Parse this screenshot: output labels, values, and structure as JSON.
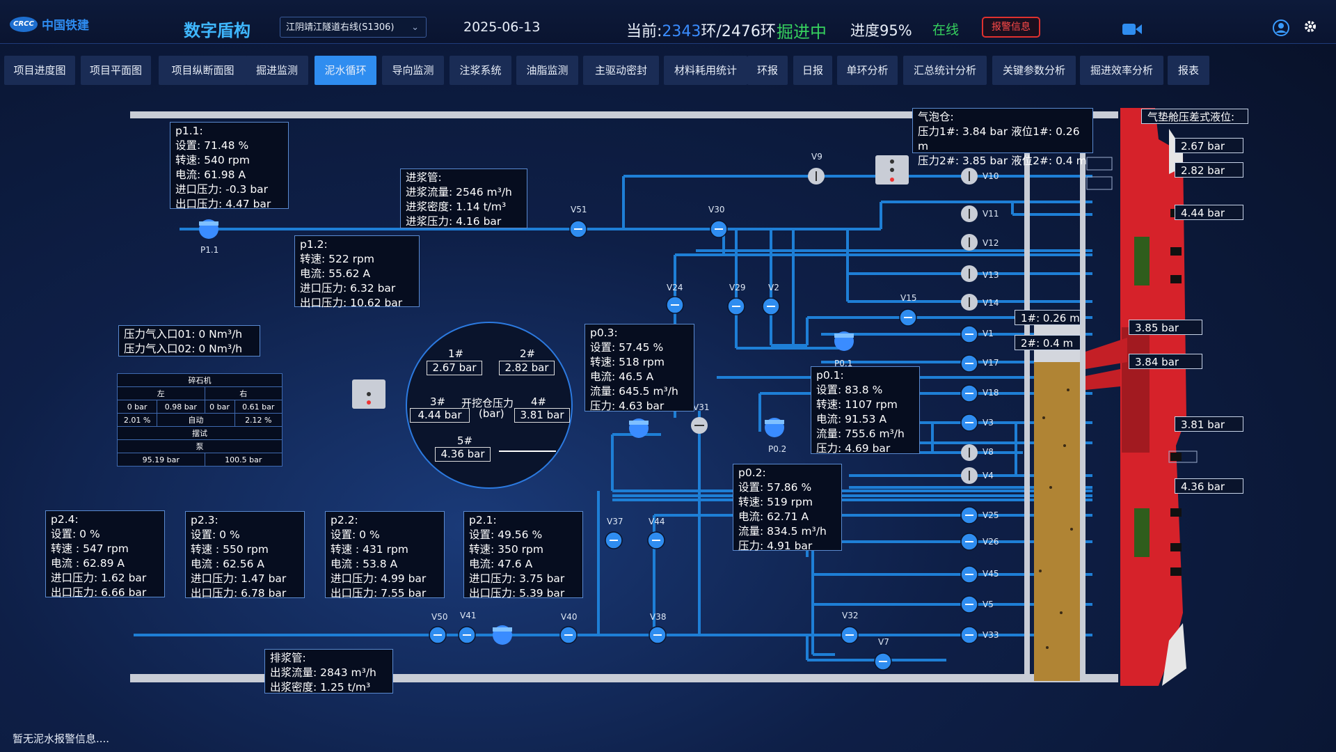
{
  "header": {
    "logo_text": "中国铁建",
    "logo_mark": "CRCC",
    "system_title": "数字盾构",
    "project_select": "江阴靖江隧道右线(S1306)",
    "date": "2025-06-13",
    "ring_prefix": "当前:",
    "ring_current": "2343",
    "ring_suffix": "环/2476环",
    "status": "掘进中",
    "progress": "进度95%",
    "online": "在线",
    "alarm_button": "报警信息"
  },
  "tabs": [
    "项目进度图",
    "项目平面图",
    "项目纵断面图",
    "掘进监测",
    "泥水循环",
    "导向监测",
    "注浆系统",
    "油脂监测",
    "主驱动密封",
    "材料耗用统计",
    "环报",
    "日报",
    "单环分析",
    "汇总统计分析",
    "关键参数分析",
    "掘进效率分析",
    "报表"
  ],
  "active_tab": "泥水循环",
  "panels": {
    "p11": [
      "p1.1:",
      "设置: 71.48 %",
      "转速: 540 rpm",
      "电流: 61.98 A",
      "进口压力: -0.3 bar",
      "出口压力: 4.47 bar"
    ],
    "p12": [
      "p1.2:",
      "转速: 522 rpm",
      "电流: 55.62 A",
      "进口压力: 6.32 bar",
      "出口压力: 10.62 bar"
    ],
    "inlet_pipe": [
      "进浆管:",
      "进浆流量: 2546 m³/h",
      "进浆密度: 1.14 t/m³",
      "进浆压力: 4.16 bar"
    ],
    "air_inlet": [
      "压力气入口01: 0 Nm³/h",
      "压力气入口02: 0 Nm³/h"
    ],
    "p03": [
      "p0.3:",
      "设置: 57.45 %",
      "转速: 518 rpm",
      "电流: 46.5 A",
      "流量: 645.5 m³/h",
      "压力: 4.63 bar"
    ],
    "p01": [
      "p0.1:",
      "设置: 83.8 %",
      "转速: 1107 rpm",
      "电流: 91.53 A",
      "流量: 755.6 m³/h",
      "压力: 4.69 bar"
    ],
    "p02": [
      "p0.2:",
      "设置: 57.86 %",
      "转速: 519 rpm",
      "电流: 62.71 A",
      "流量: 834.5 m³/h",
      "压力: 4.91 bar"
    ],
    "p24": [
      "p2.4:",
      "设置: 0 %",
      "转速 : 547 rpm",
      "电流 : 62.89 A",
      "进口压力: 1.62 bar",
      "出口压力: 6.66 bar"
    ],
    "p23": [
      "p2.3:",
      "设置: 0 %",
      "转速 : 550 rpm",
      "电流 : 62.56 A",
      "进口压力: 1.47 bar",
      "出口压力: 6.78 bar"
    ],
    "p22": [
      "p2.2:",
      "设置: 0 %",
      "转速 : 431 rpm",
      "电流 : 53.8 A",
      "进口压力: 4.99 bar",
      "出口压力: 7.55 bar"
    ],
    "p21": [
      "p2.1:",
      "设置: 49.56 %",
      "转速: 350 rpm",
      "电流: 47.6 A",
      "进口压力: 3.75 bar",
      "出口压力: 5.39 bar"
    ],
    "outlet_pipe": [
      "排浆管:",
      "出浆流量: 2843 m³/h",
      "出浆密度: 1.25 t/m³"
    ],
    "bubble": [
      "气泡仓:",
      "压力1#: 3.84 bar   液位1#: 0.26 m",
      "压力2#: 3.85 bar   液位2#: 0.4 m"
    ]
  },
  "crusher": {
    "title": "碎石机",
    "left": "左",
    "right": "右",
    "r1": [
      "0 bar",
      "0.98 bar",
      "0 bar",
      "0.61 bar"
    ],
    "r2": [
      "2.01 %",
      "自动",
      "2.12 %"
    ],
    "swing": "摆试",
    "pump": "泵",
    "r3": [
      "95.19 bar",
      "100.5 bar"
    ]
  },
  "chamber": {
    "title": "开挖仓压力",
    "unit": "(bar)",
    "l1": "1#",
    "v1": "2.67 bar",
    "l2": "2#",
    "v2": "2.82 bar",
    "l3": "3#",
    "v3": "4.44 bar",
    "l4": "4#",
    "v4": "3.81 bar",
    "l5": "5#",
    "v5": "4.36 bar"
  },
  "right_side": {
    "title": "气垫舱压差式液位:",
    "values": [
      "2.67 bar",
      "2.82 bar",
      "4.44 bar",
      "3.85 bar",
      "3.84 bar",
      "3.81 bar",
      "4.36 bar"
    ],
    "level1": "1#: 0.26 m",
    "level2": "2#: 0.4 m"
  },
  "pump_labels": [
    "P1.1",
    "P0.1",
    "P0.2"
  ],
  "valves": [
    "V9",
    "V10",
    "V11",
    "V12",
    "V13",
    "V14",
    "V15",
    "V1",
    "V17",
    "V18",
    "V3",
    "V8",
    "V4",
    "V25",
    "V26",
    "V45",
    "V5",
    "V33",
    "V32",
    "V7",
    "V51",
    "V30",
    "V24",
    "V29",
    "V2",
    "V31",
    "V37",
    "V44",
    "V50",
    "V41",
    "V40",
    "V38"
  ],
  "footer": "暂无泥水报警信息...."
}
